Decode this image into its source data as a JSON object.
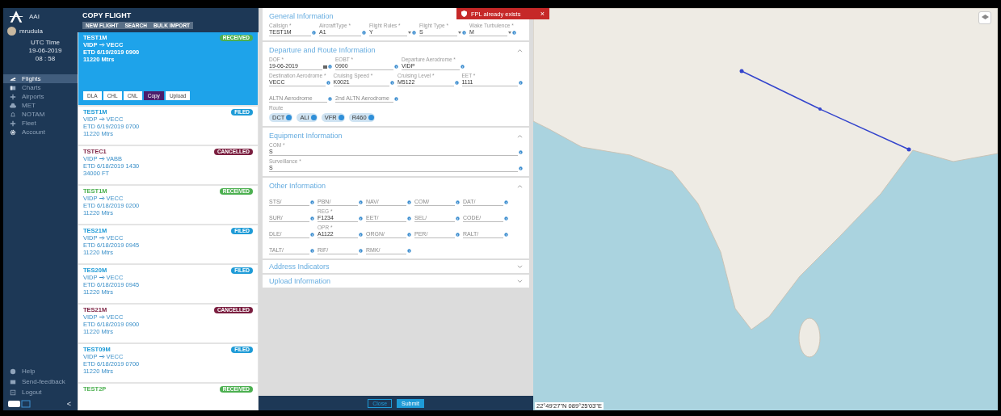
{
  "sidebar": {
    "brand": "AAI",
    "user": "mrudula",
    "clock_label": "UTC Time",
    "date": "19-06-2019",
    "time": "08 : 58",
    "items": [
      {
        "label": "Flights",
        "selected": true
      },
      {
        "label": "Charts",
        "selected": false
      },
      {
        "label": "Airports",
        "selected": false
      },
      {
        "label": "MET",
        "selected": false
      },
      {
        "label": "NOTAM",
        "selected": false
      },
      {
        "label": "Fleet",
        "selected": false
      },
      {
        "label": "Account",
        "selected": false
      }
    ],
    "footer_items": [
      "Help",
      "Send-feedback",
      "Logout"
    ],
    "collapse": "<"
  },
  "flight_list": {
    "title": "COPY FLIGHT",
    "buttons": [
      "NEW FLIGHT",
      "SEARCH",
      "BULK IMPORT"
    ],
    "flights": [
      {
        "callsign": "TEST1M",
        "from": "VIDP",
        "to": "VECC",
        "etd": "ETD 6/19/2019 0900",
        "level": "11220 Mtrs",
        "status": "RECEIVED",
        "kind": "received",
        "selected": true,
        "actions": [
          {
            "label": "DLA",
            "selected": false
          },
          {
            "label": "CHL",
            "selected": false
          },
          {
            "label": "CNL",
            "selected": false
          },
          {
            "label": "Copy",
            "selected": true
          },
          {
            "label": "Upload",
            "selected": false
          }
        ]
      },
      {
        "callsign": "TEST1M",
        "from": "VIDP",
        "to": "VECC",
        "etd": "ETD 6/19/2019 0700",
        "level": "11220 Mtrs",
        "status": "FILED",
        "kind": "filed",
        "selected": false
      },
      {
        "callsign": "TSTEC1",
        "from": "VIDP",
        "to": "VABB",
        "etd": "ETD 6/18/2019 1430",
        "level": "34000 FT",
        "status": "CANCELLED",
        "kind": "cancelled",
        "selected": false
      },
      {
        "callsign": "TEST1M",
        "from": "VIDP",
        "to": "VECC",
        "etd": "ETD 6/18/2019 0200",
        "level": "11220 Mtrs",
        "status": "RECEIVED",
        "kind": "received",
        "selected": false
      },
      {
        "callsign": "TES21M",
        "from": "VIDP",
        "to": "VECC",
        "etd": "ETD 6/18/2019 0945",
        "level": "11220 Mtrs",
        "status": "FILED",
        "kind": "filed",
        "selected": false
      },
      {
        "callsign": "TES20M",
        "from": "VIDP",
        "to": "VECC",
        "etd": "ETD 6/18/2019 0945",
        "level": "11220 Mtrs",
        "status": "FILED",
        "kind": "filed",
        "selected": false
      },
      {
        "callsign": "TES21M",
        "from": "VIDP",
        "to": "VECC",
        "etd": "ETD 6/18/2019 0900",
        "level": "11220 Mtrs",
        "status": "CANCELLED",
        "kind": "cancelled",
        "selected": false
      },
      {
        "callsign": "TEST09M",
        "from": "VIDP",
        "to": "VECC",
        "etd": "ETD 6/18/2019 0700",
        "level": "11220 Mtrs",
        "status": "FILED",
        "kind": "filed",
        "selected": false
      },
      {
        "callsign": "TEST2P",
        "status": "RECEIVED",
        "kind": "received",
        "selected": false
      }
    ]
  },
  "form": {
    "sections": [
      {
        "title": "General Information",
        "kind": "general",
        "rows": [
          [
            {
              "kind": "text",
              "label": "Callsign *",
              "value": "TEST1M"
            },
            {
              "kind": "text",
              "label": "AircraftType *",
              "value": "A1"
            },
            {
              "kind": "select",
              "label": "Flight Rules *",
              "value": "Y"
            },
            {
              "kind": "select",
              "label": "Flight Type *",
              "value": "S"
            },
            {
              "kind": "select",
              "label": "Wake Turbulence *",
              "value": "M"
            }
          ]
        ]
      },
      {
        "title": "Departure and Route Information",
        "kind": "route",
        "expanded": true,
        "rows": [
          [
            {
              "kind": "date",
              "label": "DOF *",
              "value": "19-06-2019"
            },
            {
              "kind": "text",
              "label": "EOBT *",
              "value": "0900"
            },
            {
              "kind": "text",
              "label": "Departure Aerodrome *",
              "value": "VIDP"
            }
          ],
          [
            {
              "kind": "text",
              "label": "Destination Aerodrome *",
              "value": "VECC"
            },
            {
              "kind": "text",
              "label": "Cruising Speed *",
              "value": "K0021"
            },
            {
              "kind": "text",
              "label": "Cruising Level *",
              "value": "M5122"
            },
            {
              "kind": "text",
              "label": "EET *",
              "value": "1111"
            }
          ],
          [
            {
              "kind": "text",
              "placeholder": "ALTN Aerodrome"
            },
            {
              "kind": "text",
              "placeholder": "2nd ALTN Aerodrome"
            }
          ]
        ],
        "route": {
          "label": "Route",
          "chips": [
            "DCT",
            "ALI",
            "VFR",
            "R460"
          ]
        }
      },
      {
        "title": "Equipment Information",
        "kind": "equipment",
        "expanded": true,
        "rows": [
          [
            {
              "kind": "text",
              "label": "COM *",
              "value": "S"
            }
          ],
          [
            {
              "kind": "text",
              "label": "Surveillance *",
              "value": "S"
            }
          ]
        ]
      },
      {
        "title": "Other Information",
        "kind": "other",
        "expanded": true,
        "rows": [
          [
            {
              "kind": "text",
              "placeholder": "STS/"
            },
            {
              "kind": "text",
              "placeholder": "PBN/"
            },
            {
              "kind": "text",
              "placeholder": "NAV/"
            },
            {
              "kind": "text",
              "placeholder": "COM/"
            },
            {
              "kind": "text",
              "placeholder": "DAT/"
            }
          ],
          [
            {
              "kind": "text",
              "placeholder": "SUR/"
            },
            {
              "kind": "text",
              "label": "REG *",
              "value": "F1234"
            },
            {
              "kind": "text",
              "placeholder": "EET/"
            },
            {
              "kind": "text",
              "placeholder": "SEL/"
            },
            {
              "kind": "text",
              "placeholder": "CODE/"
            }
          ],
          [
            {
              "kind": "text",
              "placeholder": "DLE/"
            },
            {
              "kind": "text",
              "label": "OPR *",
              "value": "A1122"
            },
            {
              "kind": "text",
              "placeholder": "ORGN/"
            },
            {
              "kind": "text",
              "placeholder": "PER/"
            },
            {
              "kind": "text",
              "placeholder": "RALT/"
            }
          ],
          [
            {
              "kind": "text",
              "placeholder": "TALT/"
            },
            {
              "kind": "text",
              "placeholder": "RIF/"
            },
            {
              "kind": "text",
              "placeholder": "RMK/"
            }
          ]
        ]
      },
      {
        "title": "Address Indicators",
        "kind": "collapsed",
        "expanded": false
      },
      {
        "title": "Upload Information",
        "kind": "collapsed",
        "expanded": false
      }
    ],
    "buttons": [
      {
        "label": "Close",
        "kind": "outline"
      },
      {
        "label": "Submit",
        "kind": "primary"
      }
    ]
  },
  "toast": {
    "message": "FPL already exists",
    "close": "×"
  },
  "map": {
    "coordinates": "22°49'27\"N 089°25'03\"E"
  }
}
